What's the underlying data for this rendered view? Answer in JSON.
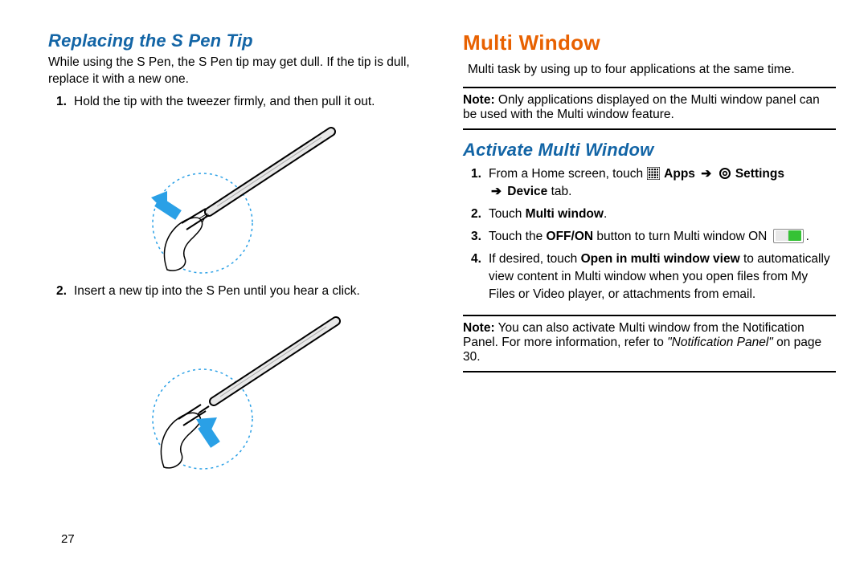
{
  "page_number": "27",
  "left": {
    "heading": "Replacing the S Pen Tip",
    "intro": "While using the S Pen, the S Pen tip may get dull. If the tip is dull, replace it with a new one.",
    "steps": {
      "s1": {
        "no": "1.",
        "text": "Hold the tip with the tweezer firmly, and then pull it out."
      },
      "s2": {
        "no": "2.",
        "text": "Insert a new tip into the S Pen until you hear a click."
      }
    }
  },
  "right": {
    "heading": "Multi Window",
    "intro": "Multi task by using up to four applications at the same time.",
    "note1_label": "Note:",
    "note1_text": " Only applications displayed on the Multi window panel can be used with the Multi window feature.",
    "sub_heading": "Activate Multi Window",
    "steps": {
      "s1": {
        "no": "1.",
        "pre": "From a Home screen, touch ",
        "apps": " Apps",
        "arrow1": " ➔ ",
        "settings": " Settings",
        "arrow2": " ➔ ",
        "device": "Device",
        "suffix": " tab."
      },
      "s2": {
        "no": "2.",
        "pre": "Touch ",
        "bold": "Multi window",
        "suffix": "."
      },
      "s3": {
        "no": "3.",
        "pre": "Touch the ",
        "bold": "OFF/ON",
        "mid": " button to turn Multi window ON ",
        "suffix": "."
      },
      "s4": {
        "no": "4.",
        "pre": "If desired, touch ",
        "bold": "Open in multi window view",
        "suffix": " to automatically view content in Multi window when you open files from My Files or Video player, or attachments from email."
      }
    },
    "note2_label": "Note:",
    "note2_text_a": " You can also activate Multi window from the Notification Panel. For more information, refer to ",
    "note2_ref": "\"Notification Panel\"",
    "note2_text_b": " on page 30."
  }
}
